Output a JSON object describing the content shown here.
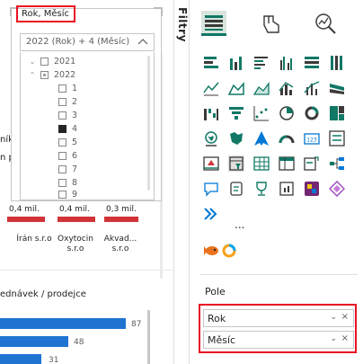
{
  "filters_tab": {
    "label": "Filtry"
  },
  "report": {
    "partial_texts": {
      "ticket_word": "níků",
      "pr_word": "n pr"
    },
    "bar_chart": {
      "value_labels": [
        "0,4 mil.",
        "0,4 mil.",
        "0,3 mil."
      ],
      "categories": [
        {
          "line1": "Írán s.r.o",
          "line2": ""
        },
        {
          "line1": "Oxytocin",
          "line2": "s.r.o"
        },
        {
          "line1": "Akvad...",
          "line2": "s.r.o"
        }
      ]
    },
    "bar_chart_2": {
      "title": "ednávek / prodejce",
      "values": [
        87,
        48,
        31
      ]
    }
  },
  "slicer": {
    "title": "Rok, Měsíc",
    "selected_value": "2022 (Rok) + 4 (Měsíc)",
    "tree": [
      {
        "label": "2021",
        "level": 0,
        "expander": "⌄",
        "state": "unchecked"
      },
      {
        "label": "2022",
        "level": 0,
        "expander": "⌃",
        "state": "partial"
      },
      {
        "label": "1",
        "level": 1,
        "state": "unchecked"
      },
      {
        "label": "2",
        "level": 1,
        "state": "unchecked"
      },
      {
        "label": "3",
        "level": 1,
        "state": "unchecked"
      },
      {
        "label": "4",
        "level": 1,
        "state": "checked"
      },
      {
        "label": "5",
        "level": 1,
        "state": "unchecked"
      },
      {
        "label": "6",
        "level": 1,
        "state": "unchecked"
      },
      {
        "label": "7",
        "level": 1,
        "state": "unchecked"
      },
      {
        "label": "8",
        "level": 1,
        "state": "unchecked"
      },
      {
        "label": "9",
        "level": 1,
        "state": "unchecked"
      }
    ]
  },
  "visualizations": {
    "tabs": [
      "build-visual-icon",
      "format-visual-icon",
      "analytics-icon"
    ],
    "more": "...",
    "fields_heading": "Pole",
    "fields": [
      {
        "name": "Rok"
      },
      {
        "name": "Měsíc"
      }
    ],
    "colors": {
      "accent": "#117865",
      "highlight": "#e81123",
      "bar_red": "#d13438",
      "bar_blue": "#1f74d1"
    }
  }
}
